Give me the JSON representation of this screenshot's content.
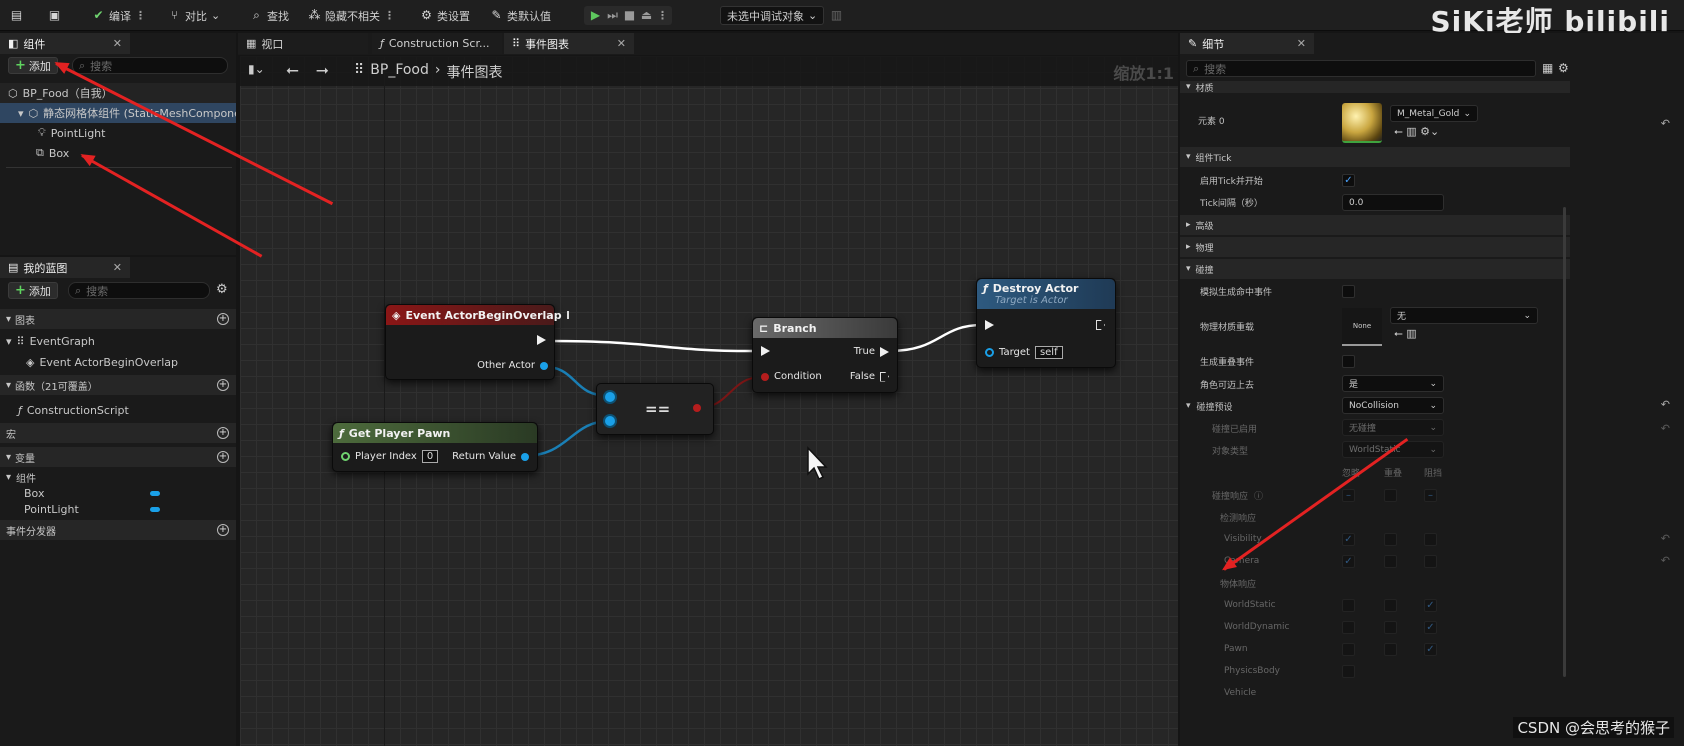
{
  "toolbar": {
    "compile": "编译",
    "diff": "对比",
    "find": "查找",
    "hide_unrelated": "隐藏不相关",
    "class_settings": "类设置",
    "class_defaults": "类默认值",
    "debug_target": "未选中调试对象",
    "brand": "SiKi老师 bilibili"
  },
  "components_panel": {
    "tab": "组件",
    "add": "添加",
    "search_placeholder": "搜索",
    "tree": [
      {
        "label": "BP_Food（自我）"
      },
      {
        "label": "静态网格体组件 (StaticMeshComponent)"
      },
      {
        "label": "PointLight"
      },
      {
        "label": "Box"
      }
    ]
  },
  "my_blueprint": {
    "tab": "我的蓝图",
    "add": "添加",
    "search_placeholder": "搜索",
    "graphs_header": "图表",
    "event_graph": "EventGraph",
    "event_item": "Event ActorBeginOverlap",
    "functions_header": "函数（21可覆盖）",
    "construction_script": "ConstructionScript",
    "macros_header": "宏",
    "variables_header": "变量",
    "components_header": "组件",
    "var_box": "Box",
    "var_pointlight": "PointLight",
    "dispatchers_header": "事件分发器"
  },
  "editor_tabs": {
    "viewport": "视口",
    "construction": "Construction Scr...",
    "event_graph": "事件图表"
  },
  "graph": {
    "breadcrumb_root": "BP_Food",
    "breadcrumb_leaf": "事件图表",
    "zoom": "缩放1:1",
    "nodes": {
      "event_overlap": {
        "title": "Event ActorBeginOverlap",
        "pin_other_actor": "Other Actor"
      },
      "get_player_pawn": {
        "title": "Get Player Pawn",
        "pin_player_index": "Player Index",
        "player_index_value": "0",
        "pin_return": "Return Value"
      },
      "equals": {
        "title": "=="
      },
      "branch": {
        "title": "Branch",
        "pin_condition": "Condition",
        "pin_true": "True",
        "pin_false": "False"
      },
      "destroy_actor": {
        "title": "Destroy Actor",
        "subtitle": "Target is Actor",
        "pin_target": "Target",
        "target_value": "self"
      }
    }
  },
  "details": {
    "tab": "细节",
    "search_placeholder": "搜索",
    "materials_header": "材质",
    "element0_label": "元素 0",
    "material_name": "M_Metal_Gold",
    "tick_header": "组件Tick",
    "start_tick_label": "启用Tick并开始",
    "tick_interval_label": "Tick间隔（秒）",
    "tick_interval_value": "0.0",
    "advanced_header": "高级",
    "physics_header": "物理",
    "collision_header": "碰撞",
    "sim_hit_label": "模拟生成命中事件",
    "phys_mat_label": "物理材质重载",
    "phys_mat_thumb": "None",
    "phys_mat_value": "无",
    "overlap_events_label": "生成重叠事件",
    "step_up_label": "角色可迈上去",
    "step_up_value": "是",
    "presets_label": "碰撞预设",
    "presets_value": "NoCollision",
    "enabled_label": "碰撞已启用",
    "enabled_value": "无碰撞",
    "object_type_label": "对象类型",
    "object_type_value": "WorldStatic",
    "col_ignore": "忽略",
    "col_overlap": "重叠",
    "col_block": "阻挡",
    "responses_label": "碰撞响应",
    "trace_header": "检测响应",
    "visibility": "Visibility",
    "camera": "Camera",
    "object_header": "物体响应",
    "world_static": "WorldStatic",
    "world_dynamic": "WorldDynamic",
    "pawn": "Pawn",
    "physics_body": "PhysicsBody",
    "vehicle": "Vehicle"
  },
  "watermark": "CSDN @会思考的猴子",
  "colors": {
    "exec_wire": "#ffffff",
    "object_pin": "#1aa0e8",
    "bool_pin": "#b51d1d",
    "event_header": "#8a1616",
    "pure_header": "#4d6b3c",
    "func_header": "#2e5a80"
  }
}
